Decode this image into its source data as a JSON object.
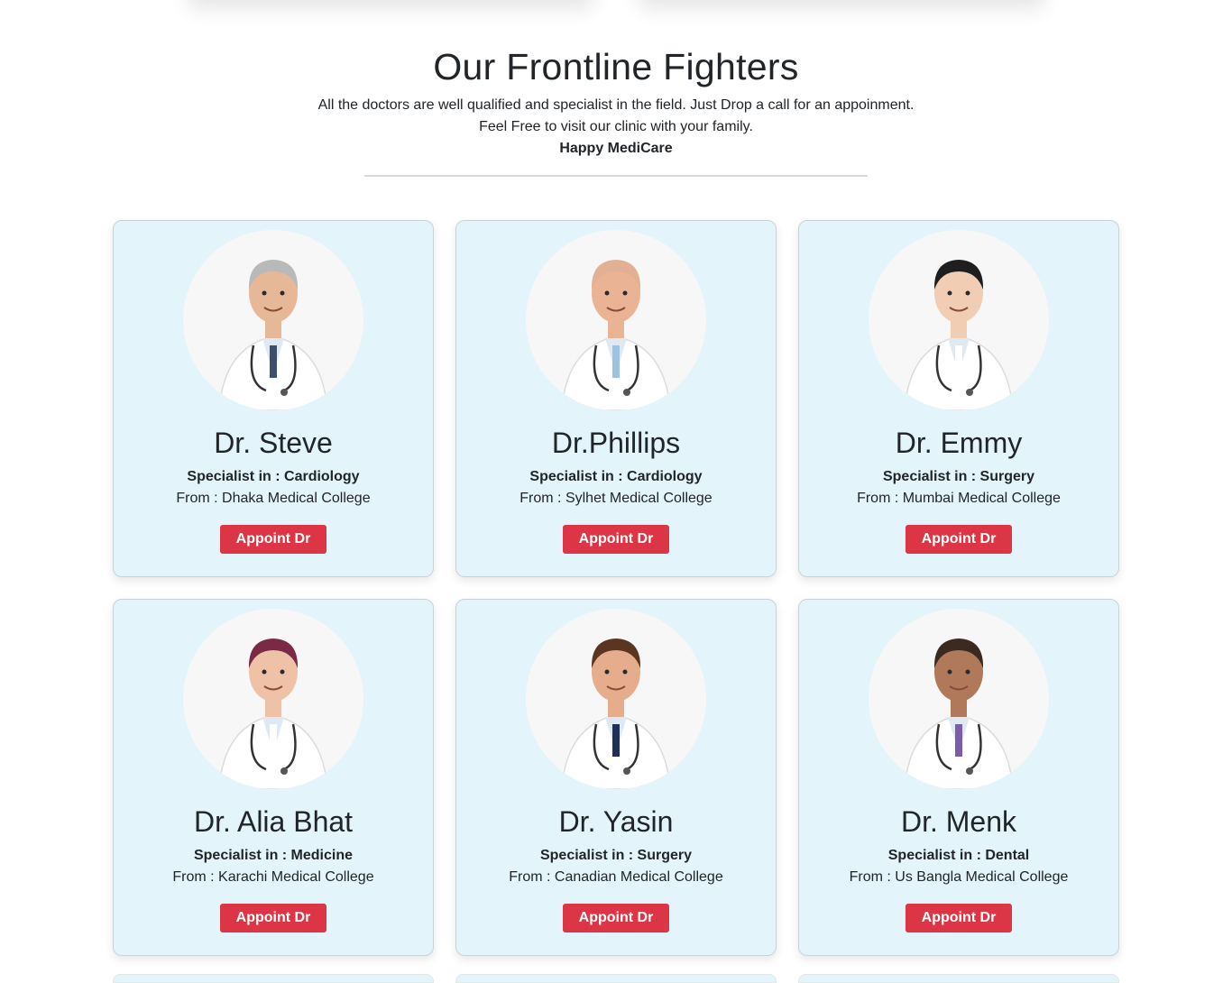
{
  "header": {
    "title": "Our Frontline Fighters",
    "line1": "All the doctors are well qualified and specialist in the field. Just Drop a call for an appoinment.",
    "line2": "Feel Free to visit our clinic with your family.",
    "line3": "Happy MediCare"
  },
  "doctors": [
    {
      "name": "Dr. Steve",
      "specialty": "Specialist in : Cardiology",
      "from": "From : Dhaka Medical College",
      "button": "Appoint Dr",
      "hair": "#b9b9b9",
      "skin": "#e7b898",
      "tie": "#3d4f6b"
    },
    {
      "name": "Dr.Phillips",
      "specialty": "Specialist in : Cardiology",
      "from": "From : Sylhet Medical College",
      "button": "Appoint Dr",
      "hair": "#e2b092",
      "skin": "#eab394",
      "tie": "#9cc3e4"
    },
    {
      "name": "Dr. Emmy",
      "specialty": "Specialist in : Surgery",
      "from": "From : Mumbai Medical College",
      "button": "Appoint Dr",
      "hair": "#1e1e1e",
      "skin": "#f1cdb3",
      "tie": "#ffffff"
    },
    {
      "name": "Dr. Alia Bhat",
      "specialty": "Specialist in : Medicine",
      "from": "From : Karachi Medical College",
      "button": "Appoint Dr",
      "hair": "#7a2a45",
      "skin": "#efc2a8",
      "tie": "#ffffff"
    },
    {
      "name": "Dr. Yasin",
      "specialty": "Specialist in : Surgery",
      "from": "From : Canadian Medical College",
      "button": "Appoint Dr",
      "hair": "#5a3520",
      "skin": "#e5ad8c",
      "tie": "#1d2f5a"
    },
    {
      "name": "Dr. Menk",
      "specialty": "Specialist in : Dental",
      "from": "From : Us Bangla Medical College",
      "button": "Appoint Dr",
      "hair": "#3a2a20",
      "skin": "#b07a5a",
      "tie": "#7c5ca8"
    }
  ]
}
